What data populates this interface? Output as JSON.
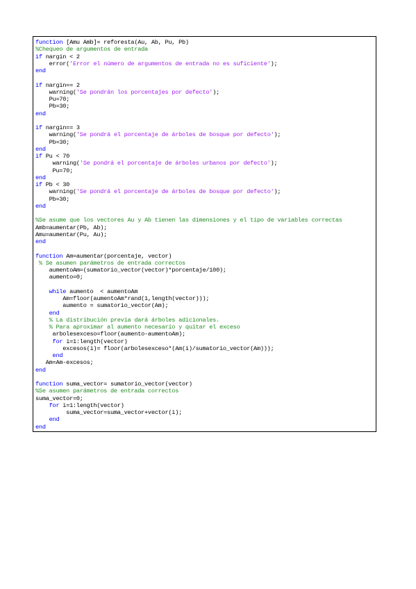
{
  "document": {
    "type": "code-listing",
    "language": "MATLAB",
    "colors": {
      "keyword": "#0000ff",
      "string": "#a020f0",
      "comment": "#228b22",
      "text": "#000000",
      "border": "#000000",
      "background": "#ffffff"
    },
    "lines": [
      [
        [
          "kw",
          "function"
        ],
        [
          "txt",
          " [Amu Amb]= reforesta(Au, Ab, Pu, Pb)"
        ]
      ],
      [
        [
          "cmt",
          "%Chequeo de argumentos de entrada"
        ]
      ],
      [
        [
          "kw",
          "if"
        ],
        [
          "txt",
          " nargin < 2"
        ]
      ],
      [
        [
          "txt",
          "    error("
        ],
        [
          "str",
          "'Error el número de argumentos de entrada no es suficiente'"
        ],
        [
          "txt",
          ");"
        ]
      ],
      [
        [
          "kw",
          "end"
        ]
      ],
      [],
      [
        [
          "kw",
          "if"
        ],
        [
          "txt",
          " nargin== 2"
        ]
      ],
      [
        [
          "txt",
          "    warning("
        ],
        [
          "str",
          "'Se pondrán los porcentajes por defecto'"
        ],
        [
          "txt",
          ");"
        ]
      ],
      [
        [
          "txt",
          "    Pu=70;"
        ]
      ],
      [
        [
          "txt",
          "    Pb=30;"
        ]
      ],
      [
        [
          "kw",
          "end"
        ]
      ],
      [],
      [
        [
          "kw",
          "if"
        ],
        [
          "txt",
          " nargin== 3"
        ]
      ],
      [
        [
          "txt",
          "    warning("
        ],
        [
          "str",
          "'Se pondrá el porcentaje de árboles de bosque por defecto'"
        ],
        [
          "txt",
          ");"
        ]
      ],
      [
        [
          "txt",
          "    Pb=30;"
        ]
      ],
      [
        [
          "kw",
          "end"
        ]
      ],
      [
        [
          "kw",
          "if"
        ],
        [
          "txt",
          " Pu < 70"
        ]
      ],
      [
        [
          "txt",
          "     warning("
        ],
        [
          "str",
          "'Se pondrá el porcentaje de árboles urbanos por defecto'"
        ],
        [
          "txt",
          ");"
        ]
      ],
      [
        [
          "txt",
          "     Pu=70;"
        ]
      ],
      [
        [
          "kw",
          "end"
        ]
      ],
      [
        [
          "kw",
          "if"
        ],
        [
          "txt",
          " Pb < 30"
        ]
      ],
      [
        [
          "txt",
          "    warning("
        ],
        [
          "str",
          "'Se pondrá el porcentaje de árboles de bosque por defecto'"
        ],
        [
          "txt",
          ");"
        ]
      ],
      [
        [
          "txt",
          "    Pb=30;"
        ]
      ],
      [
        [
          "kw",
          "end"
        ]
      ],
      [],
      [
        [
          "cmt",
          "%Se asume que los vectores Au y Ab tienen las dimensiones y el tipo de variables correctas"
        ]
      ],
      [
        [
          "txt",
          "Amb=aumentar(Pb, Ab);"
        ]
      ],
      [
        [
          "txt",
          "Amu=aumentar(Pu, Au);"
        ]
      ],
      [
        [
          "kw",
          "end"
        ]
      ],
      [],
      [
        [
          "kw",
          "function"
        ],
        [
          "txt",
          " Am=aumentar(porcentaje, vector)"
        ]
      ],
      [
        [
          "cmt",
          " % Se asumen parámetros de entrada correctos"
        ]
      ],
      [
        [
          "txt",
          "    aumentoAm=(sumatorio_vector(vector)*porcentaje/100);"
        ]
      ],
      [
        [
          "txt",
          "    aumento=0;"
        ]
      ],
      [],
      [
        [
          "txt",
          "    "
        ],
        [
          "kw",
          "while"
        ],
        [
          "txt",
          " aumento  < aumentoAm"
        ]
      ],
      [
        [
          "txt",
          "        Am=floor(aumentoAm*rand(1,length(vector)));"
        ]
      ],
      [
        [
          "txt",
          "        aumento = sumatorio_vector(Am);"
        ]
      ],
      [
        [
          "txt",
          "    "
        ],
        [
          "kw",
          "end"
        ]
      ],
      [
        [
          "txt",
          "    "
        ],
        [
          "cmt",
          "% La distribución previa dará árboles adicionales."
        ]
      ],
      [
        [
          "txt",
          "    "
        ],
        [
          "cmt",
          "% Para aproximar al aumento necesario y quitar el exceso"
        ]
      ],
      [
        [
          "txt",
          "     arbolesexceso=floor(aumento-aumentoAm);"
        ]
      ],
      [
        [
          "txt",
          "     "
        ],
        [
          "kw",
          "for"
        ],
        [
          "txt",
          " i=1:length(vector)"
        ]
      ],
      [
        [
          "txt",
          "        excesos(i)= floor(arbolesexceso*(Am(i)/sumatorio_vector(Am)));"
        ]
      ],
      [
        [
          "txt",
          "     "
        ],
        [
          "kw",
          "end"
        ]
      ],
      [
        [
          "txt",
          "   Am=Am-excesos;"
        ]
      ],
      [
        [
          "kw",
          "end"
        ]
      ],
      [],
      [
        [
          "kw",
          "function"
        ],
        [
          "txt",
          " suma_vector= sumatorio_vector(vector)"
        ]
      ],
      [
        [
          "cmt",
          "%Se asumen parámetros de entrada correctos"
        ]
      ],
      [
        [
          "txt",
          "suma_vector=0;"
        ]
      ],
      [
        [
          "txt",
          "    "
        ],
        [
          "kw",
          "for"
        ],
        [
          "txt",
          " i=1:length(vector)"
        ]
      ],
      [
        [
          "txt",
          "         suma_vector=suma_vector+vector(i);"
        ]
      ],
      [
        [
          "txt",
          "    "
        ],
        [
          "kw",
          "end"
        ]
      ],
      [
        [
          "kw",
          "end"
        ]
      ]
    ]
  }
}
